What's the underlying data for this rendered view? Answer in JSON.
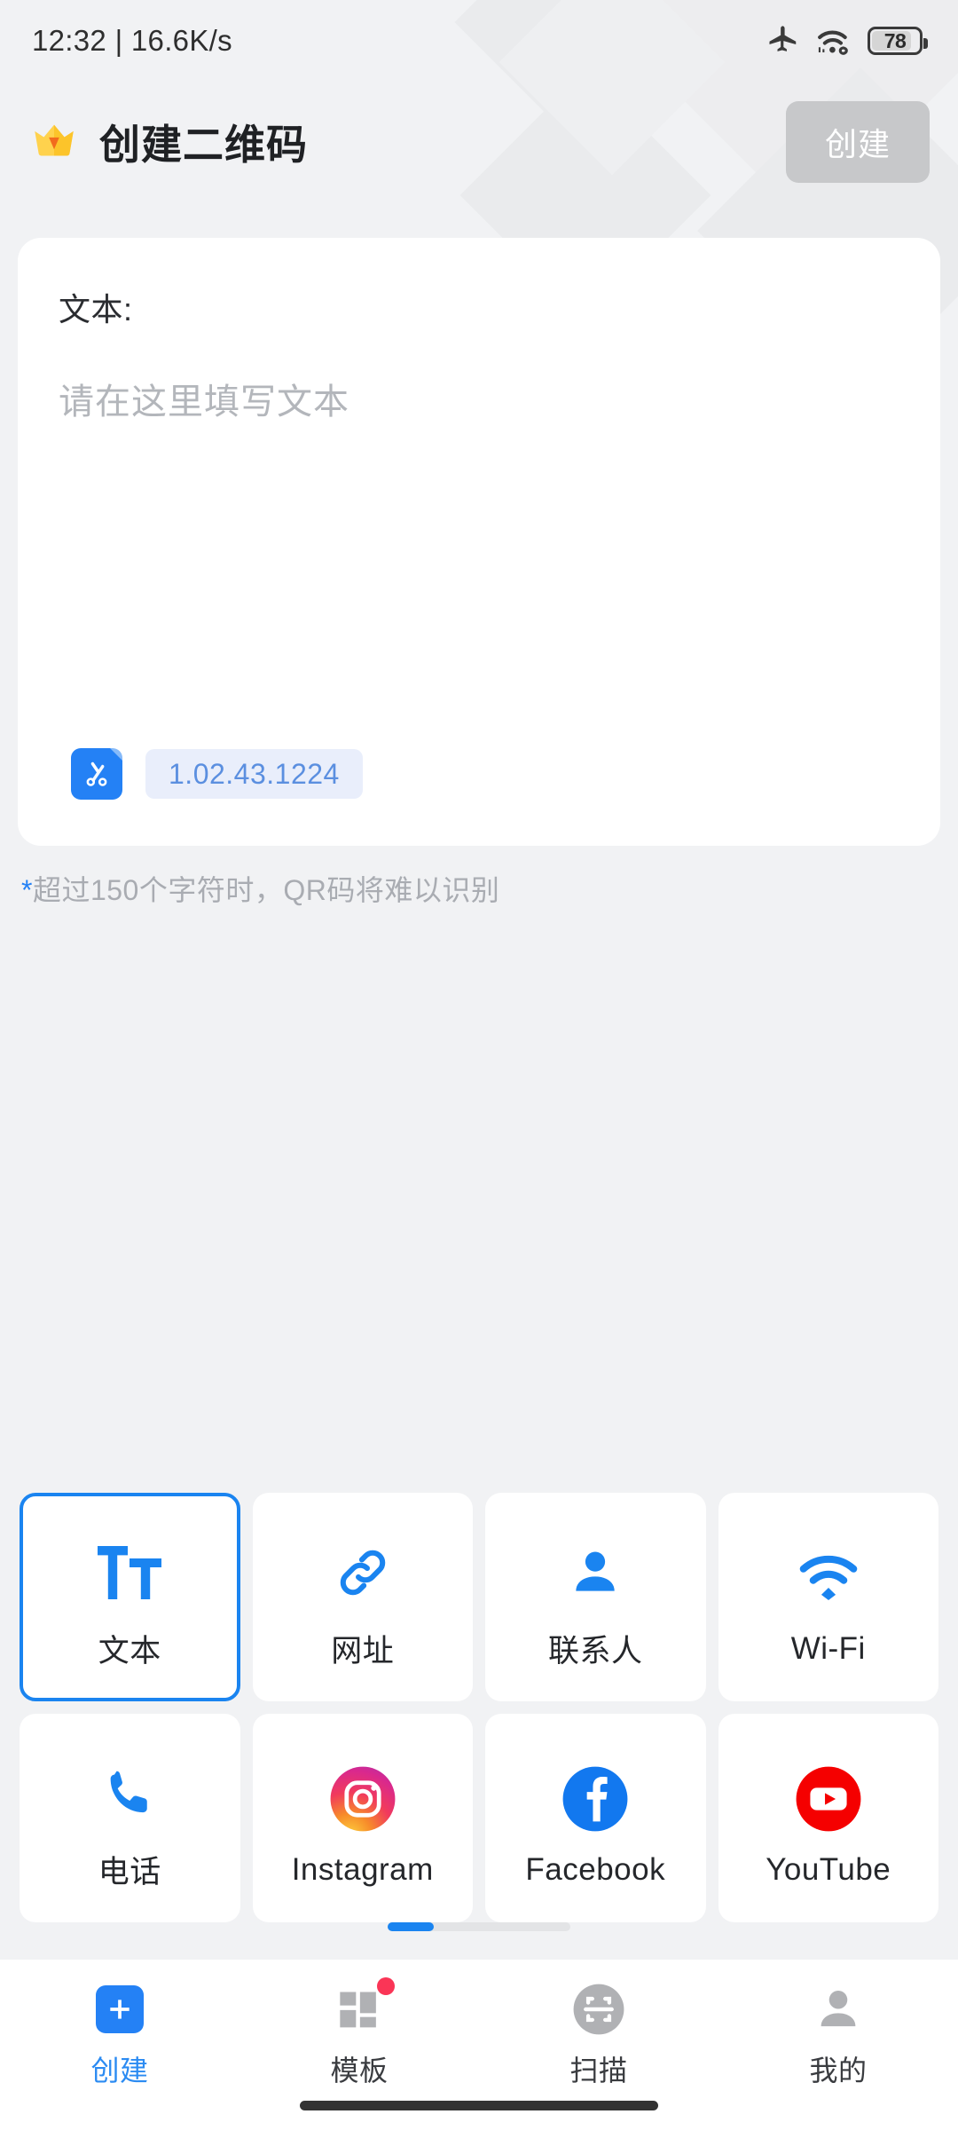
{
  "status_bar": {
    "time": "12:32",
    "separator": "|",
    "network_speed": "16.6K/s",
    "icons": [
      "airplane-mode-icon",
      "wifi-icon",
      "battery-icon"
    ],
    "battery_level": "78"
  },
  "header": {
    "vip_icon": "crown-icon",
    "title": "创建二维码",
    "create_button": "创建"
  },
  "input_card": {
    "label": "文本:",
    "placeholder": "请在这里填写文本",
    "value": "",
    "clipboard_icon": "scissors-clipboard-icon",
    "clipboard_chip": "1.02.43.1224"
  },
  "hint": {
    "star": "*",
    "text": "超过150个字符时，QR码将难以识别"
  },
  "type_grid": {
    "tiles": [
      {
        "label": "文本",
        "icon": "text-format-icon",
        "selected": true
      },
      {
        "label": "网址",
        "icon": "link-icon",
        "selected": false
      },
      {
        "label": "联系人",
        "icon": "person-icon",
        "selected": false
      },
      {
        "label": "Wi-Fi",
        "icon": "wifi-icon",
        "selected": false
      },
      {
        "label": "电话",
        "icon": "phone-icon",
        "selected": false
      },
      {
        "label": "Instagram",
        "icon": "instagram-icon",
        "selected": false
      },
      {
        "label": "Facebook",
        "icon": "facebook-icon",
        "selected": false
      },
      {
        "label": "YouTube",
        "icon": "youtube-icon",
        "selected": false
      }
    ]
  },
  "page_indicator": {
    "pages": 4,
    "active": 1
  },
  "bottom_nav": {
    "items": [
      {
        "label": "创建",
        "icon": "plus-square-icon",
        "active": true,
        "badge": false
      },
      {
        "label": "模板",
        "icon": "grid-icon",
        "active": false,
        "badge": true
      },
      {
        "label": "扫描",
        "icon": "scan-icon",
        "active": false,
        "badge": false
      },
      {
        "label": "我的",
        "icon": "person-icon",
        "active": false,
        "badge": false
      }
    ]
  },
  "colors": {
    "accent": "#2481f5",
    "background": "#f1f2f4",
    "card": "#ffffff",
    "muted_text": "#a9acb2",
    "badge": "#fa3556"
  }
}
